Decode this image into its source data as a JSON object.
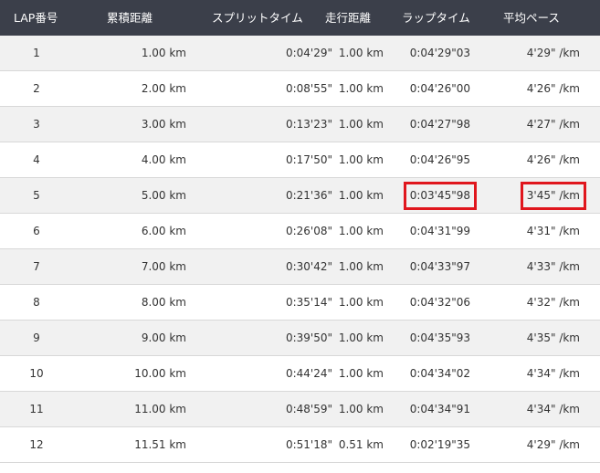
{
  "headers": {
    "lap": "LAP番号",
    "cumulative": "累積距離",
    "split": "スプリットタイム",
    "run_distance": "走行距離",
    "lap_time": "ラップタイム",
    "avg_pace": "平均ペース"
  },
  "rows": [
    {
      "lap": "1",
      "cumulative": "1.00 km",
      "split": "0:04'29\"",
      "run_distance": "1.00 km",
      "lap_time": "0:04'29\"03",
      "avg_pace": "4'29\" /km"
    },
    {
      "lap": "2",
      "cumulative": "2.00 km",
      "split": "0:08'55\"",
      "run_distance": "1.00 km",
      "lap_time": "0:04'26\"00",
      "avg_pace": "4'26\" /km"
    },
    {
      "lap": "3",
      "cumulative": "3.00 km",
      "split": "0:13'23\"",
      "run_distance": "1.00 km",
      "lap_time": "0:04'27\"98",
      "avg_pace": "4'27\" /km"
    },
    {
      "lap": "4",
      "cumulative": "4.00 km",
      "split": "0:17'50\"",
      "run_distance": "1.00 km",
      "lap_time": "0:04'26\"95",
      "avg_pace": "4'26\" /km"
    },
    {
      "lap": "5",
      "cumulative": "5.00 km",
      "split": "0:21'36\"",
      "run_distance": "1.00 km",
      "lap_time": "0:03'45\"98",
      "avg_pace": "3'45\" /km"
    },
    {
      "lap": "6",
      "cumulative": "6.00 km",
      "split": "0:26'08\"",
      "run_distance": "1.00 km",
      "lap_time": "0:04'31\"99",
      "avg_pace": "4'31\" /km"
    },
    {
      "lap": "7",
      "cumulative": "7.00 km",
      "split": "0:30'42\"",
      "run_distance": "1.00 km",
      "lap_time": "0:04'33\"97",
      "avg_pace": "4'33\" /km"
    },
    {
      "lap": "8",
      "cumulative": "8.00 km",
      "split": "0:35'14\"",
      "run_distance": "1.00 km",
      "lap_time": "0:04'32\"06",
      "avg_pace": "4'32\" /km"
    },
    {
      "lap": "9",
      "cumulative": "9.00 km",
      "split": "0:39'50\"",
      "run_distance": "1.00 km",
      "lap_time": "0:04'35\"93",
      "avg_pace": "4'35\" /km"
    },
    {
      "lap": "10",
      "cumulative": "10.00 km",
      "split": "0:44'24\"",
      "run_distance": "1.00 km",
      "lap_time": "0:04'34\"02",
      "avg_pace": "4'34\" /km"
    },
    {
      "lap": "11",
      "cumulative": "11.00 km",
      "split": "0:48'59\"",
      "run_distance": "1.00 km",
      "lap_time": "0:04'34\"91",
      "avg_pace": "4'34\" /km"
    },
    {
      "lap": "12",
      "cumulative": "11.51 km",
      "split": "0:51'18\"",
      "run_distance": "0.51 km",
      "lap_time": "0:02'19\"35",
      "avg_pace": "4'29\" /km"
    }
  ],
  "highlight": {
    "row_lap": "5",
    "color": "#e0161d"
  },
  "colors": {
    "header_bg": "#3b3f4a",
    "row_odd": "#f1f1f1",
    "row_even": "#ffffff"
  }
}
